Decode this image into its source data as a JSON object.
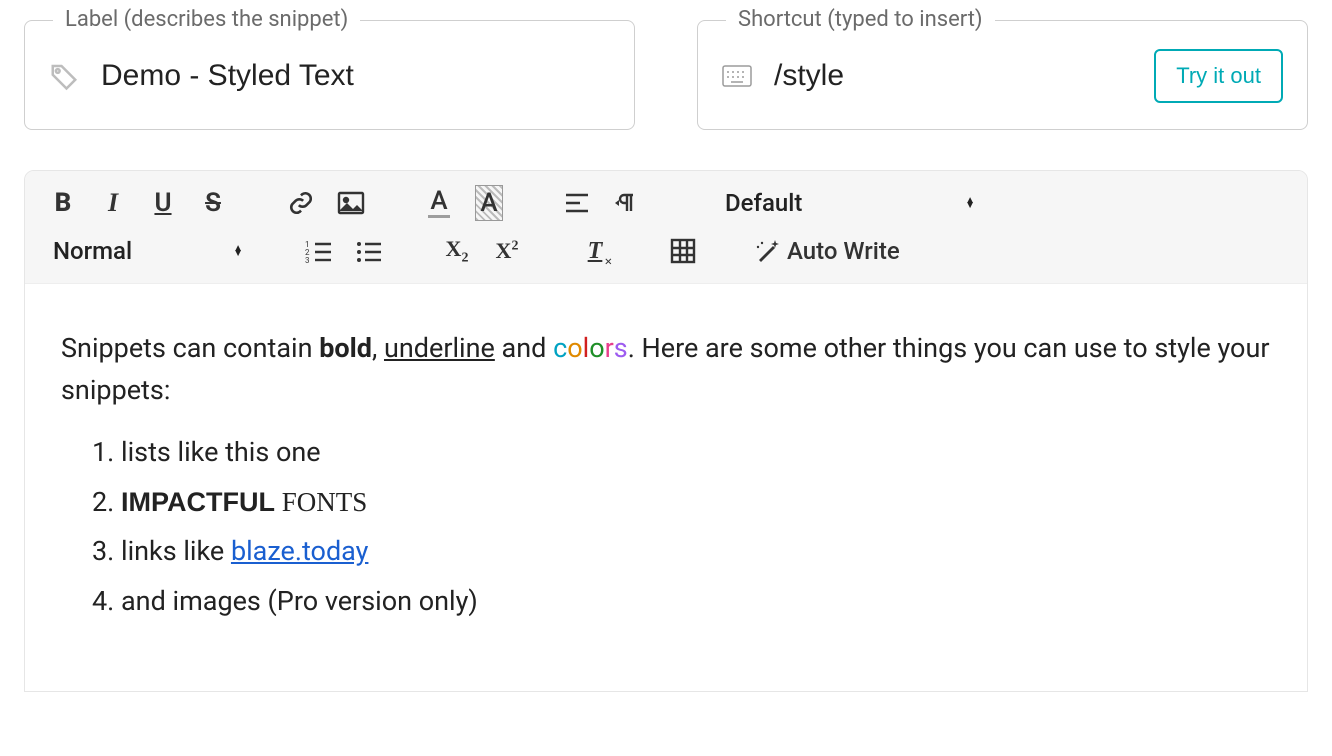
{
  "labelField": {
    "legend": "Label (describes the snippet)",
    "value": "Demo - Styled Text"
  },
  "shortcutField": {
    "legend": "Shortcut (typed to insert)",
    "value": "/style",
    "tryButton": "Try it out"
  },
  "toolbar": {
    "row1": {
      "fontSelect": "Default"
    },
    "row2": {
      "paragraphSelect": "Normal",
      "autoWrite": "Auto Write"
    }
  },
  "content": {
    "intro": {
      "prefix": "Snippets can contain ",
      "bold": "bold",
      "sep1": ", ",
      "underline": "underline",
      "sep2": " and ",
      "colors": [
        "c",
        "o",
        "l",
        "o",
        "r",
        "s"
      ],
      "suffix": ". Here are some other things you can use to style your snippets:"
    },
    "list": {
      "item1": "lists like this one",
      "item2": {
        "impact": "IMPACTFUL",
        "space": " ",
        "serif": "FONTS"
      },
      "item3": {
        "prefix": "links like ",
        "link": "blaze.today"
      },
      "item4": "and images (Pro version only)"
    }
  }
}
